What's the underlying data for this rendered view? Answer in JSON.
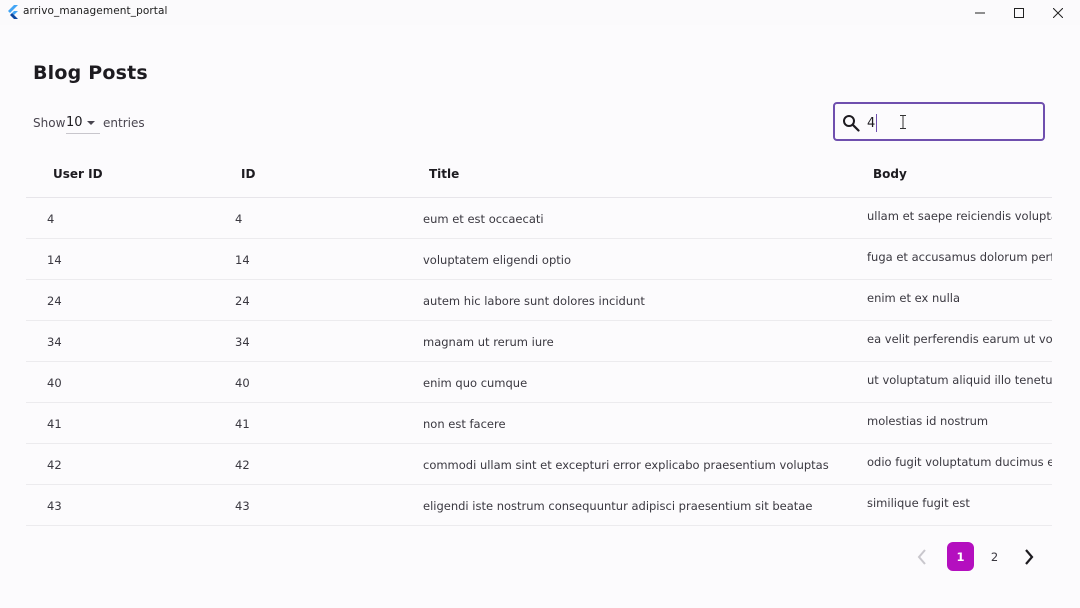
{
  "window": {
    "title": "arrivo_management_portal"
  },
  "page": {
    "title": "Blog Posts"
  },
  "entries": {
    "show_label": "Show",
    "selected": "10",
    "suffix_label": "entries"
  },
  "search": {
    "value": "4",
    "placeholder": ""
  },
  "table": {
    "columns": [
      "User ID",
      "ID",
      "Title",
      "Body"
    ],
    "rows": [
      [
        "4",
        "4",
        "eum et est occaecati",
        "ullam et saepe reiciendis voluptatem adipisci"
      ],
      [
        "14",
        "14",
        "voluptatem eligendi optio",
        "fuga et accusamus dolorum perferendis illo voluptas"
      ],
      [
        "24",
        "24",
        "autem hic labore sunt dolores incidunt",
        "enim et ex nulla"
      ],
      [
        "34",
        "34",
        "magnam ut rerum iure",
        "ea velit perferendis earum ut voluptatem voluptate"
      ],
      [
        "40",
        "40",
        "enim quo cumque",
        "ut voluptatum aliquid illo tenetur nemo sequi quo"
      ],
      [
        "41",
        "41",
        "non est facere",
        "molestias id nostrum"
      ],
      [
        "42",
        "42",
        "commodi ullam sint et excepturi error explicabo praesentium voluptas",
        "odio fugit voluptatum ducimus earum autem est"
      ],
      [
        "43",
        "43",
        "eligendi iste nostrum consequuntur adipisci praesentium sit beatae",
        "similique fugit est"
      ]
    ]
  },
  "pagination": {
    "pages": [
      "1",
      "2"
    ],
    "current": "1"
  },
  "colors": {
    "accent": "#6f4fae",
    "active_page": "#b40fbf",
    "background": "#fcfbfd"
  },
  "icons": {
    "app": "flutter-logo-icon",
    "search": "search-icon",
    "prev": "chevron-left-icon",
    "next": "chevron-right-icon",
    "dropdown": "dropdown-arrow-icon"
  }
}
